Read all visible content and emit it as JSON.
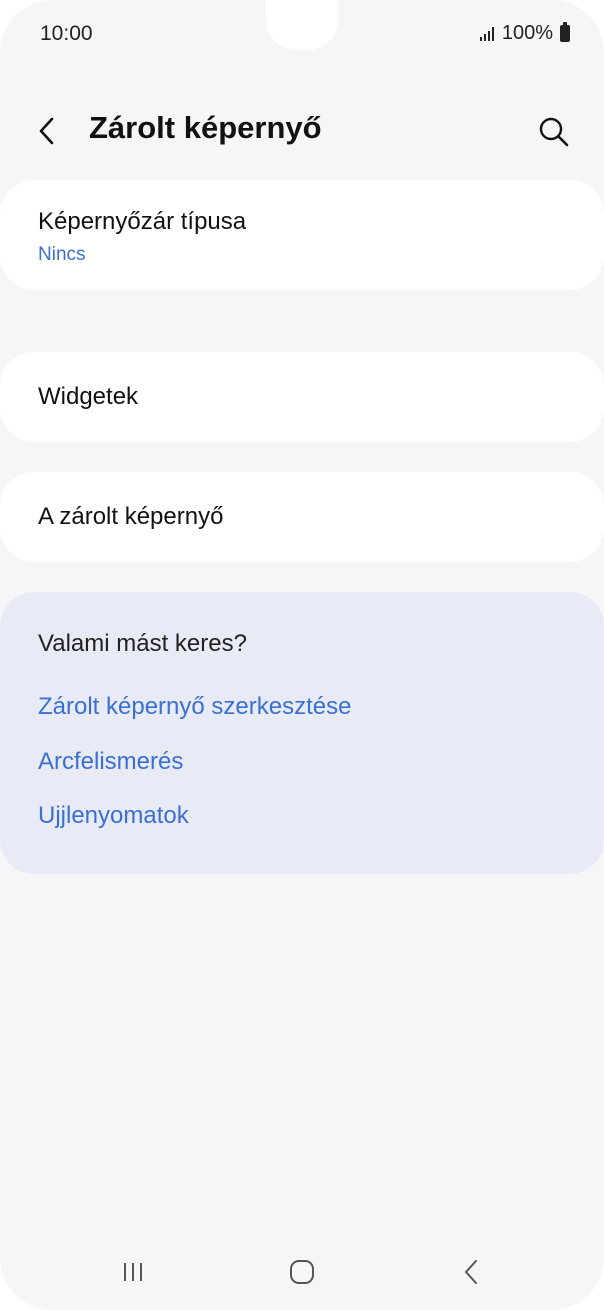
{
  "status_bar": {
    "time": "10:00",
    "battery": "100%",
    "icons": [
      "signal-icon",
      "battery-icon"
    ]
  },
  "header": {
    "title": "Zárolt képernyő",
    "back_icon": "chevron-left-icon",
    "search_icon": "search-icon"
  },
  "settings": {
    "screen_lock_type": {
      "label": "Képernyőzár típusa",
      "value": "Nincs"
    },
    "widgets": {
      "label": "Widgetek"
    },
    "about": {
      "label": "A zárolt képernyő"
    }
  },
  "suggestions": {
    "heading": "Valami mást keres?",
    "links": [
      "Zárolt képernyő szerkesztése",
      "Arcfelismerés",
      "Ujjlenyomatok"
    ]
  },
  "nav_bar": {
    "icons": [
      "recent-apps-icon",
      "home-icon",
      "back-icon"
    ]
  },
  "colors": {
    "background": "#f6f6f8",
    "card": "#ffffff",
    "suggestion_card": "#e8ebf6",
    "link": "#3b6fd1",
    "text": "#111111"
  }
}
